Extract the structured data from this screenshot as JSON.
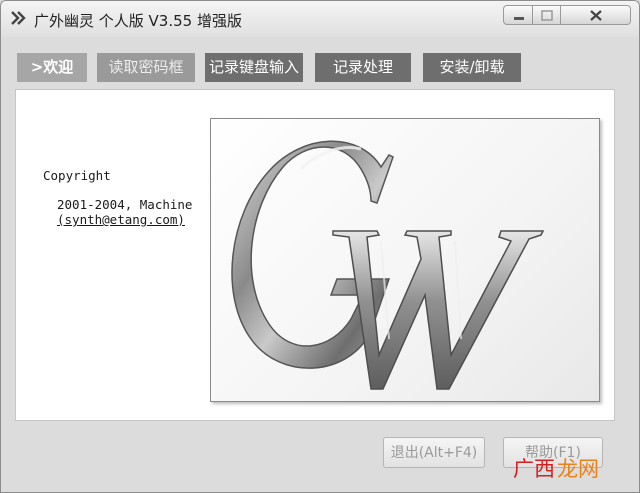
{
  "window": {
    "title": "广外幽灵 个人版 V3.55 增强版"
  },
  "tabs": [
    {
      "label": ">欢迎",
      "state": "active"
    },
    {
      "label": "读取密码框",
      "state": "disabled"
    },
    {
      "label": "记录键盘输入",
      "state": "normal"
    },
    {
      "label": "记录处理",
      "state": "normal"
    },
    {
      "label": "安装/卸载",
      "state": "normal"
    }
  ],
  "about": {
    "copyright_label": "Copyright",
    "years_author": "2001-2004, Machine",
    "email": "(synth@etang.com)"
  },
  "logo": {
    "text": "GW",
    "icon": "gw-logo-graphic"
  },
  "buttons": {
    "exit_label": "退出(Alt+F4)",
    "help_label": "帮助(F1)"
  },
  "watermark": {
    "first": "广西",
    "second": "龙网"
  },
  "colors": {
    "tab_active": "#a6a6a6",
    "tab_disabled": "#9a9a9a",
    "tab_normal": "#6e6e6e",
    "watermark_red": "#d32020",
    "watermark_orange": "#e8831a"
  }
}
